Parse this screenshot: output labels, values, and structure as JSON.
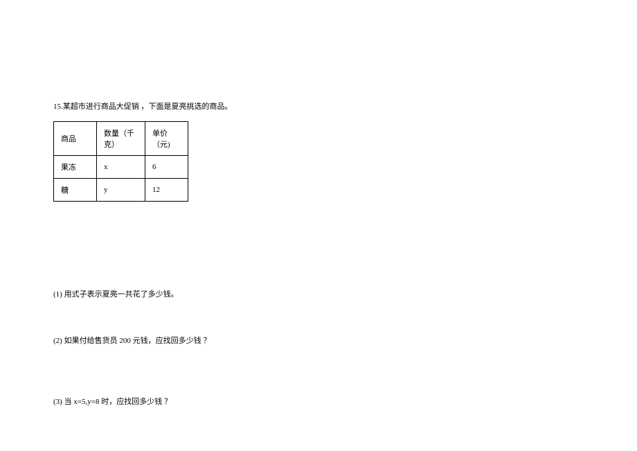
{
  "problem": {
    "number": "15.",
    "intro": "某超市进行商品大促销 ，下面是夏亮挑选的商品。"
  },
  "table": {
    "headers": {
      "col1": "商品",
      "col2": "数量（千克）",
      "col3": "单价（元)"
    },
    "rows": [
      {
        "col1": "果冻",
        "col2": "x",
        "col3": "6"
      },
      {
        "col1": "糖",
        "col2": "y",
        "col3": "12"
      }
    ]
  },
  "questions": {
    "q1": "(1) 用式子表示夏亮一共花了多少钱。",
    "q2": "(2) 如果付给售货员  200 元钱，应找回多少钱 ？",
    "q3": "(3) 当 x=5,y=8  时，应找回多少钱 ？"
  }
}
